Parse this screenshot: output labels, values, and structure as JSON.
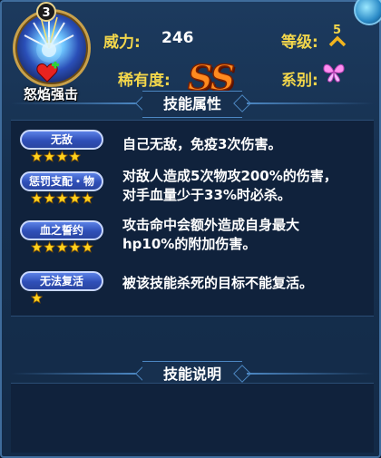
{
  "skill": {
    "name": "怒焰强击",
    "level": "3"
  },
  "stats": {
    "power_label": "威力:",
    "power_value": "246",
    "grade_label": "等级:",
    "grade_value": "5",
    "rarity_label": "稀有度:",
    "rarity_value": "SS",
    "type_label": "系别:"
  },
  "sections": {
    "attributes_title": "技能属性",
    "explanation_title": "技能说明"
  },
  "attributes": [
    {
      "name": "无敌",
      "stars": 4,
      "description_lines": [
        "自己无敌，免疫3次伤害。"
      ]
    },
    {
      "name": "惩罚支配・物",
      "stars": 5,
      "description_lines": [
        "对敌人造成5次物攻200%的伤害，",
        "对手血量少于33%时必杀。"
      ]
    },
    {
      "name": "血之誓约",
      "stars": 5,
      "description_lines": [
        "攻击命中会额外造成自身最大",
        "hp10%的附加伤害。"
      ]
    },
    {
      "name": "无法复活",
      "stars": 1,
      "description_lines": [
        "被该技能杀死的目标不能复活。"
      ]
    }
  ],
  "colors": {
    "label_gold": "#f2d64b",
    "rarity_orange": "#ff8a1f",
    "star_yellow": "#ffd21e",
    "pill_blue": "#2f4fb8"
  },
  "icons": {
    "skill_icon": "blue-energy-burst-icon",
    "heart_plus": "heart-plus-icon",
    "grade_arrow": "up-chevron-icon",
    "type": "butterfly-icon",
    "corner": "blue-gem-icon"
  }
}
